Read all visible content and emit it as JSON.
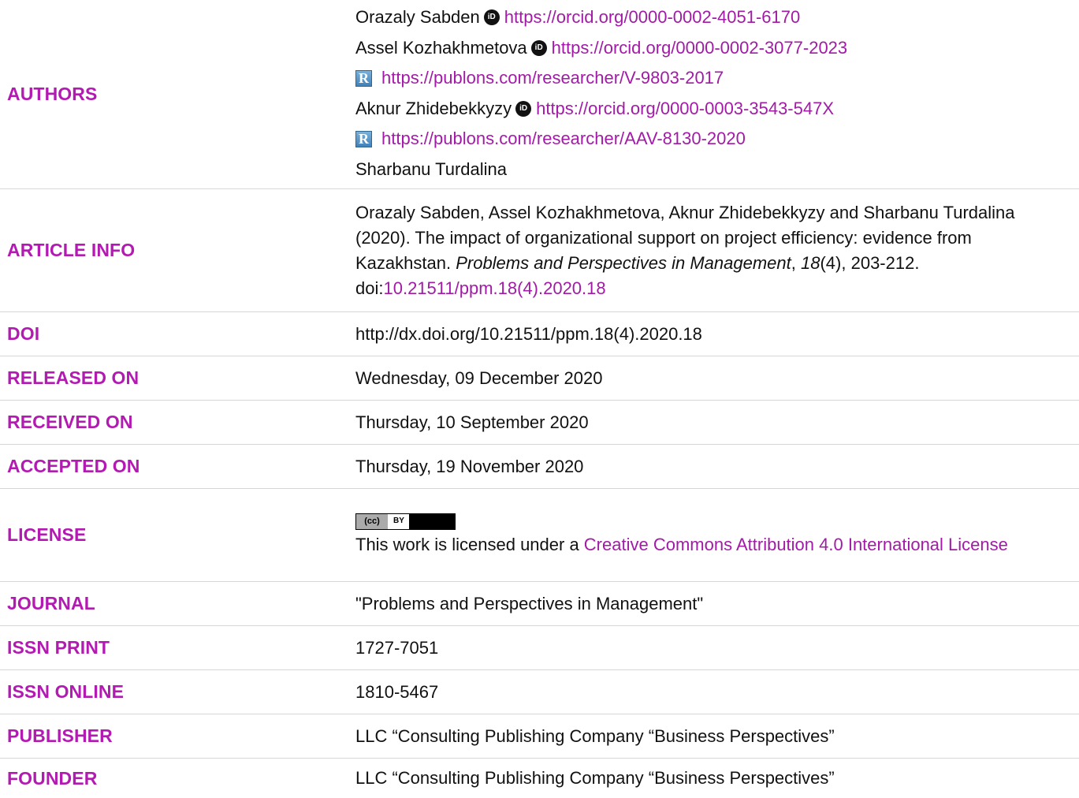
{
  "authors": {
    "label": "AUTHORS",
    "list": [
      {
        "name": "Orazaly Sabden",
        "orcid": "https://orcid.org/0000-0002-4051-6170"
      },
      {
        "name": "Assel Kozhakhmetova",
        "orcid": "https://orcid.org/0000-0002-3077-2023",
        "publons": "https://publons.com/researcher/V-9803-2017"
      },
      {
        "name": "Aknur Zhidebekkyzy",
        "orcid": "https://orcid.org/0000-0003-3543-547X",
        "publons": "https://publons.com/researcher/AAV-8130-2020"
      },
      {
        "name": "Sharbanu Turdalina"
      }
    ]
  },
  "article_info": {
    "label": "ARTICLE INFO",
    "authors_year": "Orazaly Sabden, Assel Kozhakhmetova, Aknur Zhidebekkyzy and Sharbanu Turdalina (2020). The impact of organizational support on project efficiency: evidence from Kazakhstan.",
    "journal_italic": "Problems and Perspectives in Management",
    "comma": ", ",
    "volume_italic": "18",
    "issue_pages": "(4), 203-212. doi:",
    "doi_link": "10.21511/ppm.18(4).2020.18"
  },
  "doi": {
    "label": "DOI",
    "value": "http://dx.doi.org/10.21511/ppm.18(4).2020.18"
  },
  "released_on": {
    "label": "RELEASED ON",
    "value": "Wednesday, 09 December 2020"
  },
  "received_on": {
    "label": "RECEIVED ON",
    "value": "Thursday, 10 September 2020"
  },
  "accepted_on": {
    "label": "ACCEPTED ON",
    "value": "Thursday, 19 November 2020"
  },
  "license": {
    "label": "LICENSE",
    "badge_left": "(cc)",
    "badge_mid": "BY",
    "text_prefix": "This work is licensed under a ",
    "link_text": "Creative Commons Attribution 4.0 International License"
  },
  "journal": {
    "label": "JOURNAL",
    "value": "\"Problems and Perspectives in Management\""
  },
  "issn_print": {
    "label": "ISSN PRINT",
    "value": "1727-7051"
  },
  "issn_online": {
    "label": "ISSN ONLINE",
    "value": "1810-5467"
  },
  "publisher": {
    "label": "PUBLISHER",
    "value": "LLC “Consulting Publishing Company “Business Perspectives”"
  },
  "founder": {
    "label": "FOUNDER",
    "value": "LLC “Consulting Publishing Company “Business Perspectives”"
  },
  "icons": {
    "orcid": "orcid-icon",
    "publons": "publons-icon",
    "cc_by": "cc-by-badge"
  },
  "colors": {
    "label": "#b21ab2",
    "link": "#a21ba6",
    "divider": "#d7d7d7"
  }
}
